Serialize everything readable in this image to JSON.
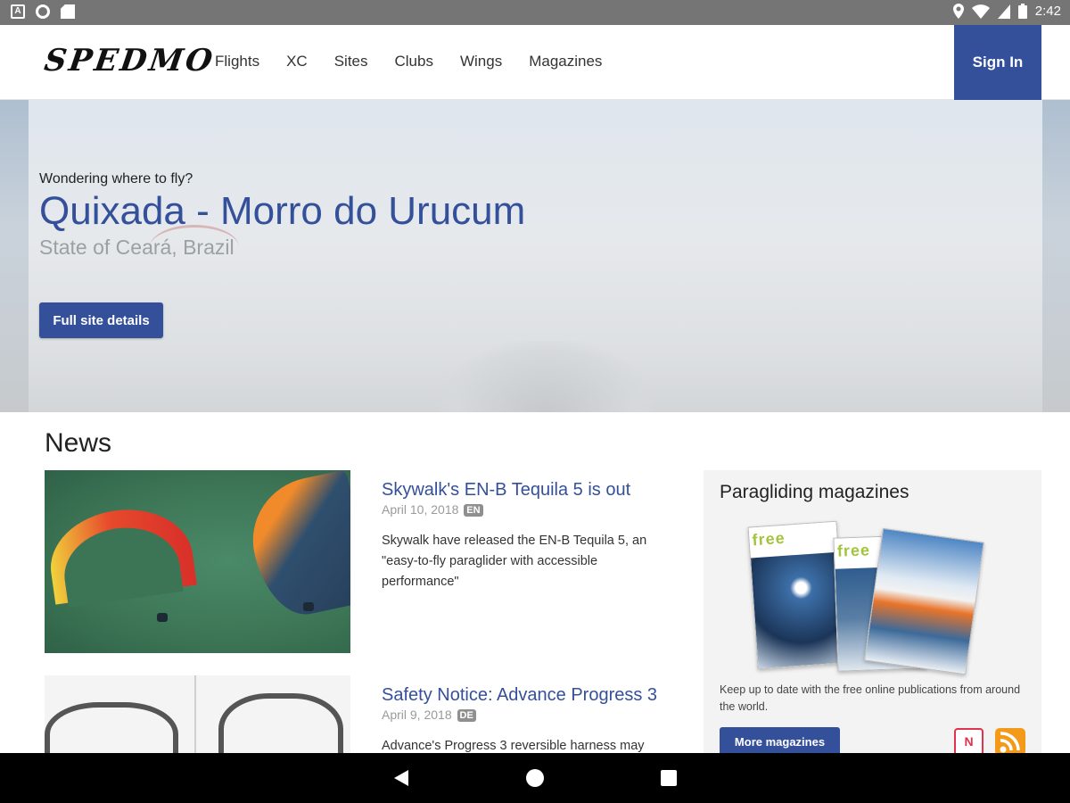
{
  "status_bar": {
    "time": "2:42"
  },
  "header": {
    "logo": "SPEDMO",
    "nav": [
      "Flights",
      "XC",
      "Sites",
      "Clubs",
      "Wings",
      "Magazines"
    ],
    "sign_in": "Sign In"
  },
  "hero": {
    "pretitle": "Wondering where to fly?",
    "title": "Quixada - Morro do Urucum",
    "subtitle": "State of Ceará, Brazil",
    "button": "Full site details"
  },
  "news": {
    "heading": "News",
    "articles": [
      {
        "title": "Skywalk's EN-B Tequila 5 is out",
        "date": "April 10, 2018",
        "lang": "EN",
        "text": "Skywalk have released the EN-B Tequila 5, an \"easy-to-fly paraglider with accessible performance\""
      },
      {
        "title": "Safety Notice: Advance Progress 3",
        "date": "April 9, 2018",
        "lang": "DE",
        "text": "Advance's Progress 3 reversible harness may"
      }
    ]
  },
  "sidebar": {
    "heading": "Paragliding magazines",
    "mag_label": "free",
    "text": "Keep up to date with the free online publications from around the world.",
    "button": "More magazines"
  },
  "colors": {
    "accent": "#34509a",
    "status_bar": "#757575",
    "sidebar_bg": "#f3f3f3"
  }
}
